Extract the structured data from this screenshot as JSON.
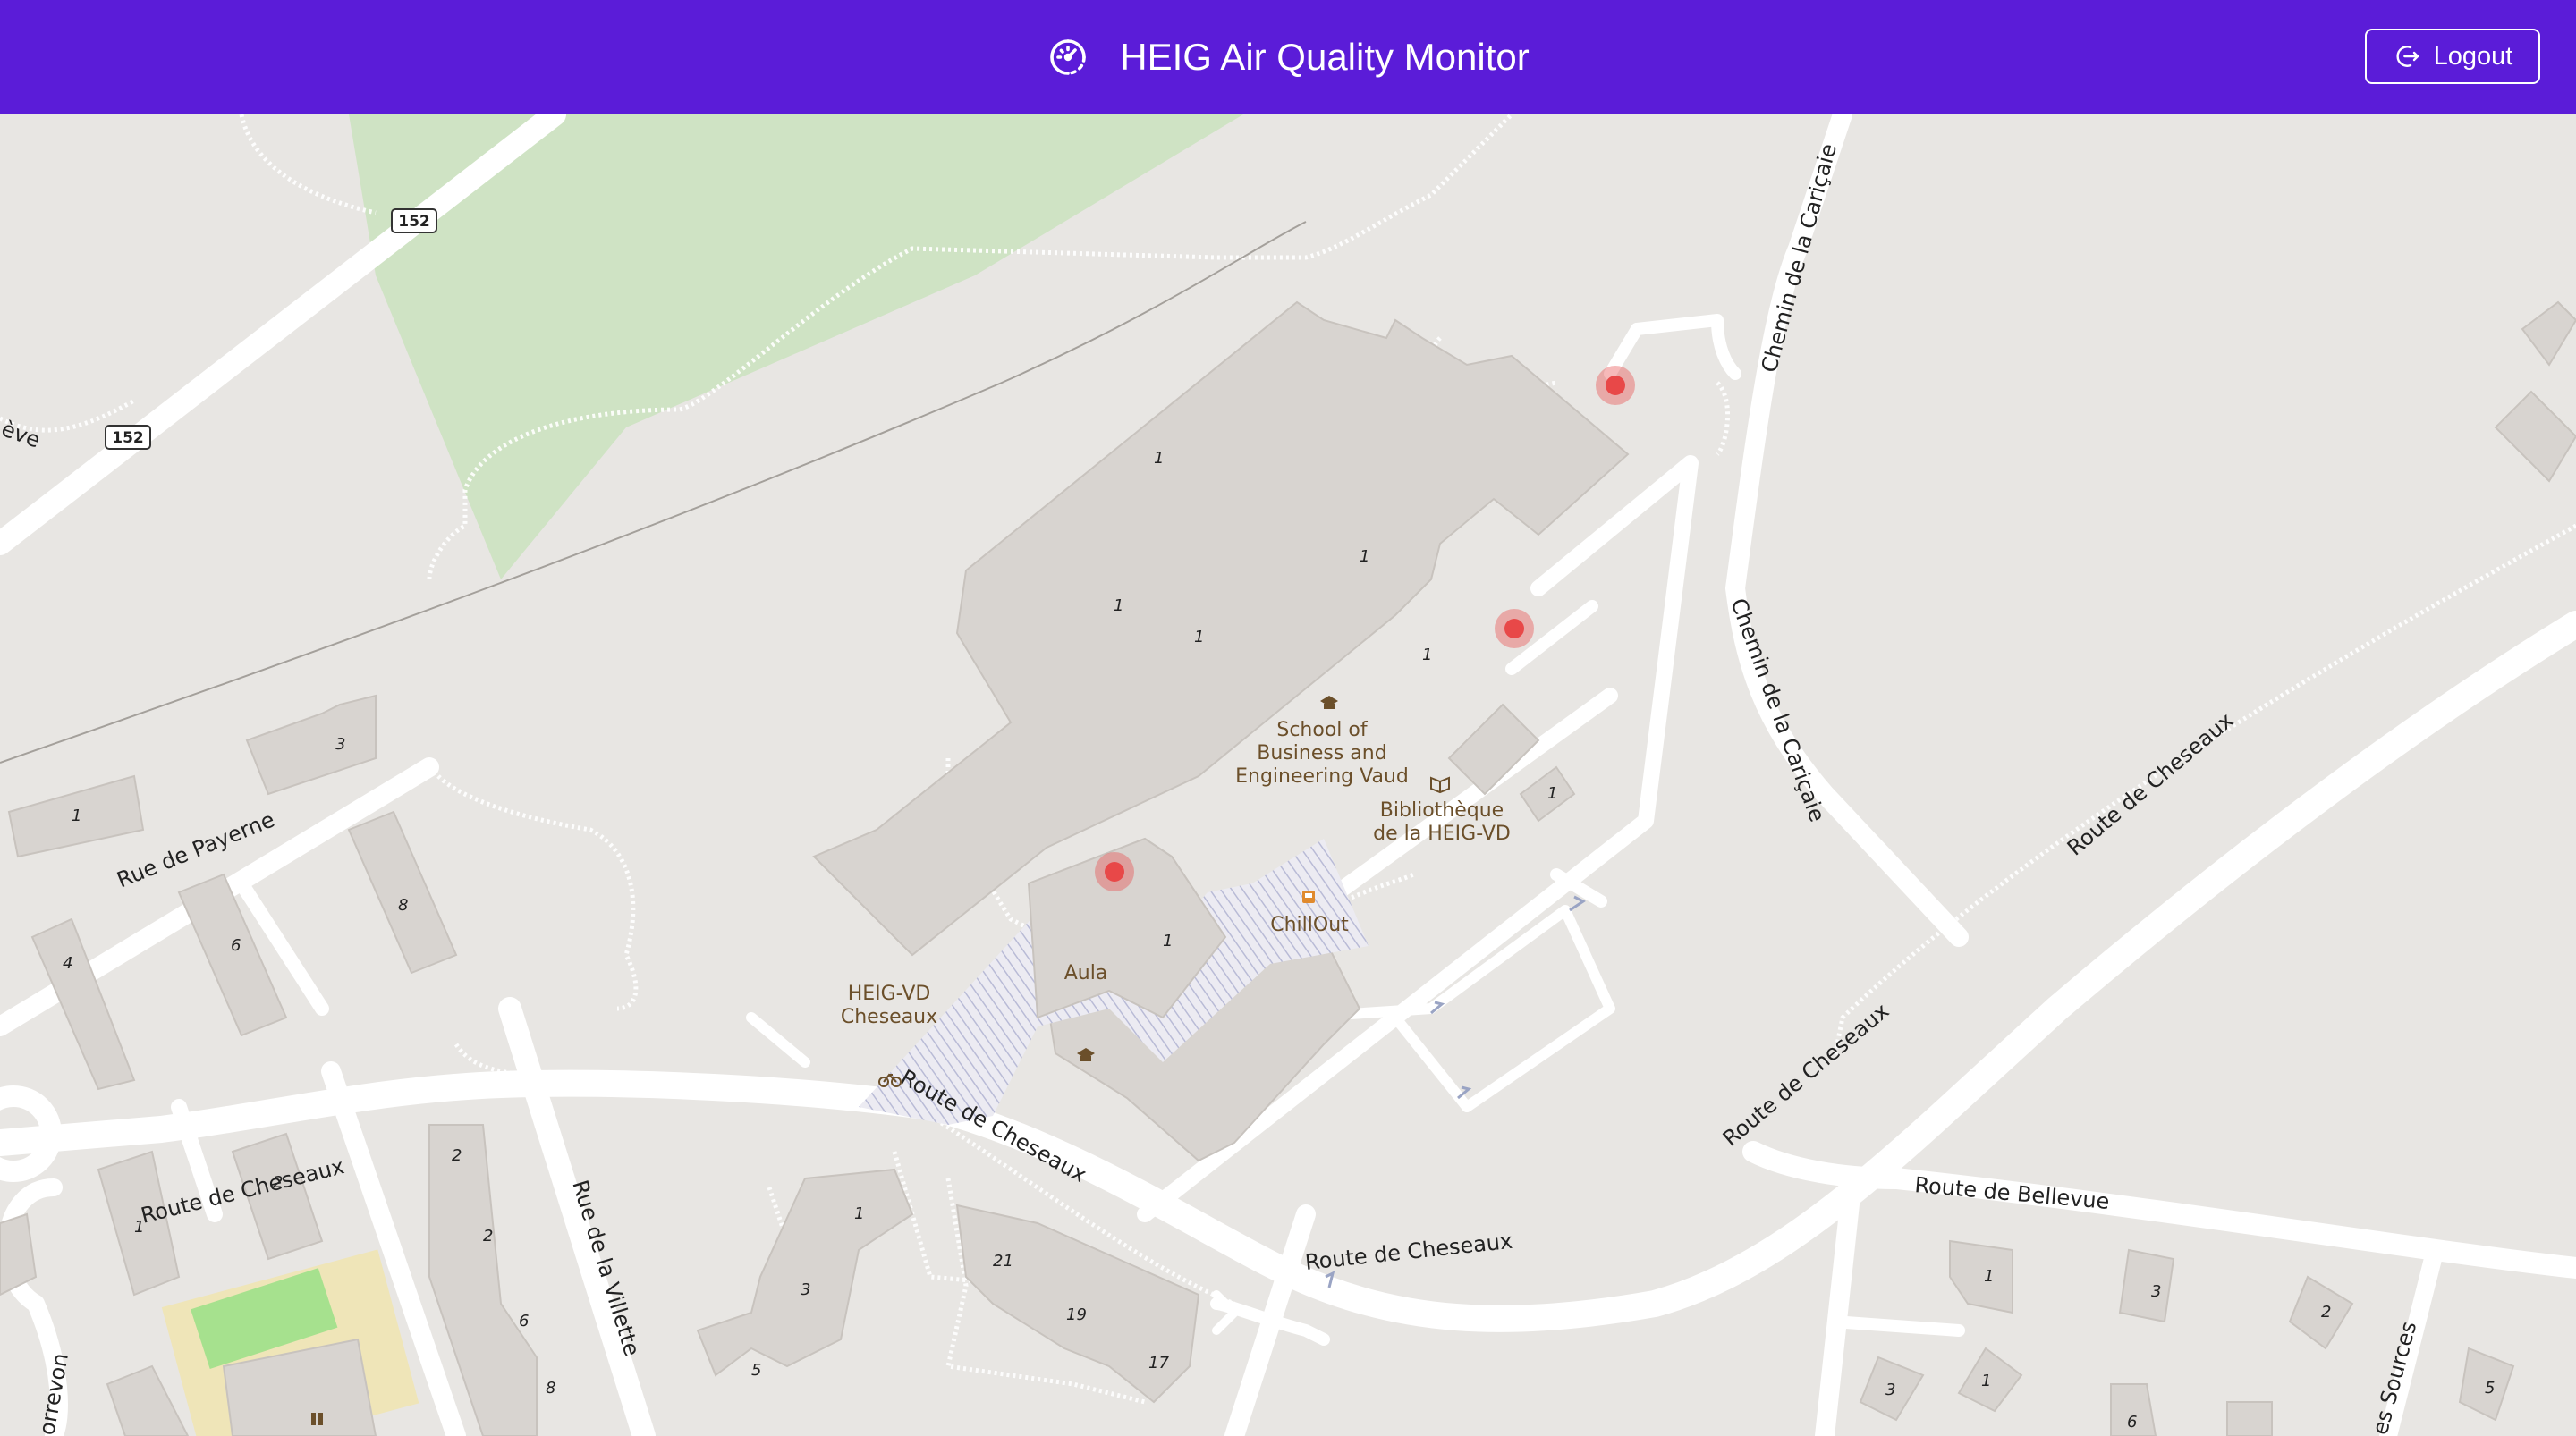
{
  "app": {
    "title": "HEIG Air Quality Monitor",
    "logo_icon": "gauge-icon",
    "logout_label": "Logout",
    "logout_icon": "logout-icon",
    "header_color": "#5b1cd8"
  },
  "map": {
    "streets": {
      "route_cheseaux": "Route de Cheseaux",
      "rue_payerne": "Rue de Payerne",
      "chemin_caricaie": "Chemin de la Cariçaie",
      "route_bellevue": "Route de Bellevue",
      "rue_villette": "Rue de la Villette",
      "route_152": "152",
      "edge_left_top": "ève",
      "edge_bottom_left": "orrevon",
      "edge_bottom_right": "es Sources"
    },
    "pois": {
      "school_line1": "School of",
      "school_line2": "Business and",
      "school_line3": "Engineering Vaud",
      "library_line1": "Bibliothèque",
      "library_line2": "de la HEIG-VD",
      "chillout": "ChillOut",
      "aula": "Aula",
      "heig_line1": "HEIG-VD",
      "heig_line2": "Cheseaux"
    },
    "building_numbers": [
      "1",
      "1",
      "1",
      "1",
      "1",
      "1",
      "1",
      "1",
      "3",
      "1",
      "2",
      "4",
      "6",
      "8",
      "2",
      "1",
      "2",
      "4",
      "6",
      "8",
      "1",
      "3",
      "5",
      "21",
      "19",
      "17",
      "1",
      "2",
      "3",
      "1",
      "3",
      "2",
      "6",
      "5"
    ],
    "sensor_color": "#e84848",
    "sensors_count": 3
  }
}
